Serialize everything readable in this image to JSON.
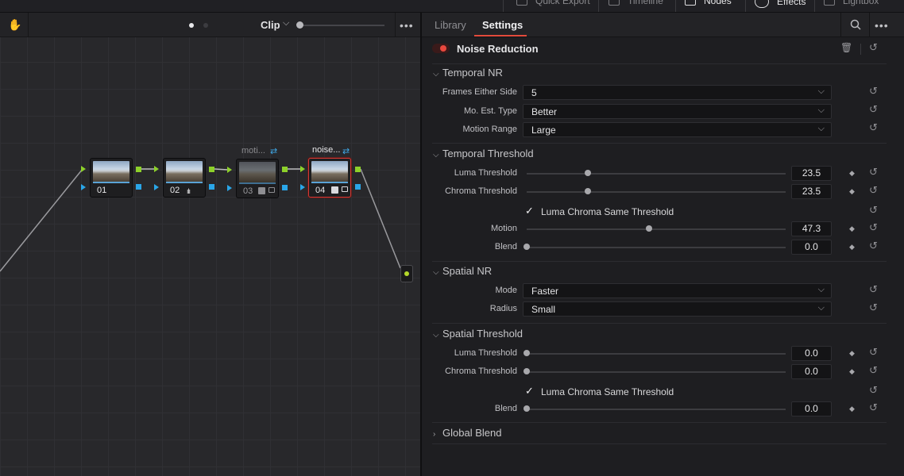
{
  "topbar": {
    "items": [
      {
        "label": "Quick Export",
        "icon": "export-icon",
        "active": false
      },
      {
        "label": "Timeline",
        "icon": "timeline-icon",
        "active": false
      },
      {
        "label": "Nodes",
        "icon": "nodes-icon",
        "active": true
      },
      {
        "label": "Effects",
        "icon": "fx-icon",
        "active": true
      },
      {
        "label": "Lightbox",
        "icon": "lightbox-icon",
        "active": false
      }
    ]
  },
  "node_editor": {
    "clip_label": "Clip",
    "nodes": [
      {
        "id": "01",
        "label": "",
        "state": "normal"
      },
      {
        "id": "02",
        "label": "",
        "state": "normal"
      },
      {
        "id": "03",
        "label": "moti...",
        "state": "disabled"
      },
      {
        "id": "04",
        "label": "noise...",
        "state": "selected"
      }
    ]
  },
  "inspector": {
    "tabs": [
      {
        "label": "Library",
        "active": false
      },
      {
        "label": "Settings",
        "active": true
      }
    ],
    "effect": {
      "title": "Noise Reduction",
      "enabled": true
    },
    "sections": {
      "temporal_nr": {
        "title": "Temporal NR",
        "frames_either_side": {
          "label": "Frames Either Side",
          "value": "5"
        },
        "mo_est_type": {
          "label": "Mo. Est. Type",
          "value": "Better"
        },
        "motion_range": {
          "label": "Motion Range",
          "value": "Large"
        }
      },
      "temporal_threshold": {
        "title": "Temporal Threshold",
        "luma": {
          "label": "Luma Threshold",
          "value": "23.5",
          "fraction": 0.235
        },
        "chroma": {
          "label": "Chroma Threshold",
          "value": "23.5",
          "fraction": 0.235
        },
        "same_threshold": {
          "label": "Luma Chroma Same Threshold",
          "checked": true
        },
        "motion": {
          "label": "Motion",
          "value": "47.3",
          "fraction": 0.473
        },
        "blend": {
          "label": "Blend",
          "value": "0.0",
          "fraction": 0.0
        }
      },
      "spatial_nr": {
        "title": "Spatial NR",
        "mode": {
          "label": "Mode",
          "value": "Faster"
        },
        "radius": {
          "label": "Radius",
          "value": "Small"
        }
      },
      "spatial_threshold": {
        "title": "Spatial Threshold",
        "luma": {
          "label": "Luma Threshold",
          "value": "0.0",
          "fraction": 0.0
        },
        "chroma": {
          "label": "Chroma Threshold",
          "value": "0.0",
          "fraction": 0.0
        },
        "same_threshold": {
          "label": "Luma Chroma Same Threshold",
          "checked": true
        },
        "blend": {
          "label": "Blend",
          "value": "0.0",
          "fraction": 0.0
        }
      },
      "global_blend": {
        "title": "Global Blend",
        "expanded": false
      }
    }
  },
  "colors": {
    "accent_red": "#e34a3c",
    "green_port": "#8dd12a",
    "blue_port": "#2aa6e8",
    "selected_node_border": "#d23a36"
  }
}
